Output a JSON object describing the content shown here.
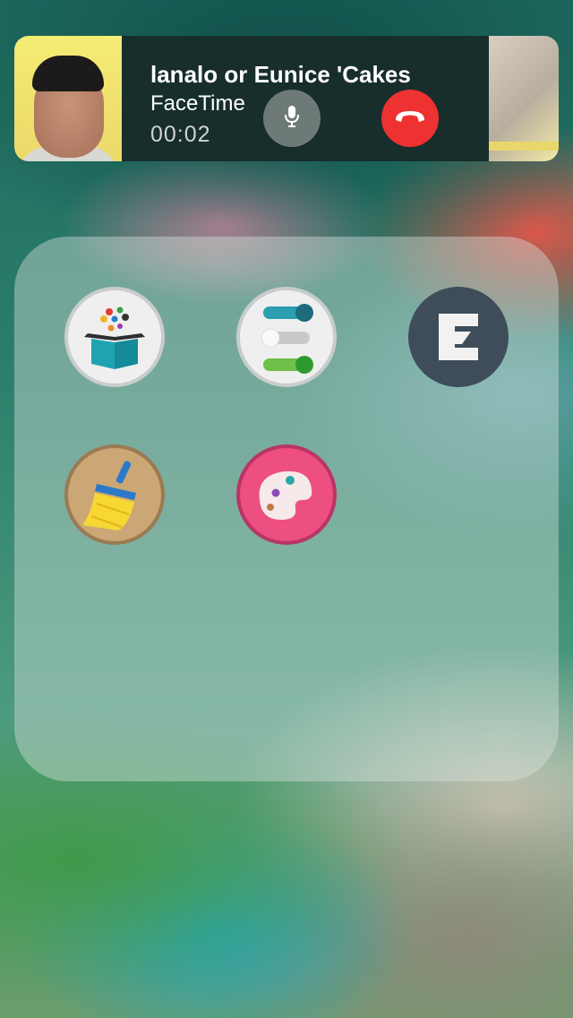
{
  "call": {
    "caller_name": "lanalo or Eunice 'Cakes",
    "app_name": "FaceTime",
    "duration": "00:02"
  },
  "icons": {
    "mute": "microphone-icon",
    "end": "phone-hangup-icon"
  },
  "colors": {
    "end_call": "#ee3131",
    "mute_button": "#6e7a78"
  },
  "folder": {
    "apps": [
      {
        "icon": "open-box-app-icon"
      },
      {
        "icon": "toggle-switches-app-icon"
      },
      {
        "icon": "e-letter-app-icon"
      },
      {
        "icon": "broom-cleaner-app-icon"
      },
      {
        "icon": "paint-palette-app-icon"
      }
    ]
  }
}
